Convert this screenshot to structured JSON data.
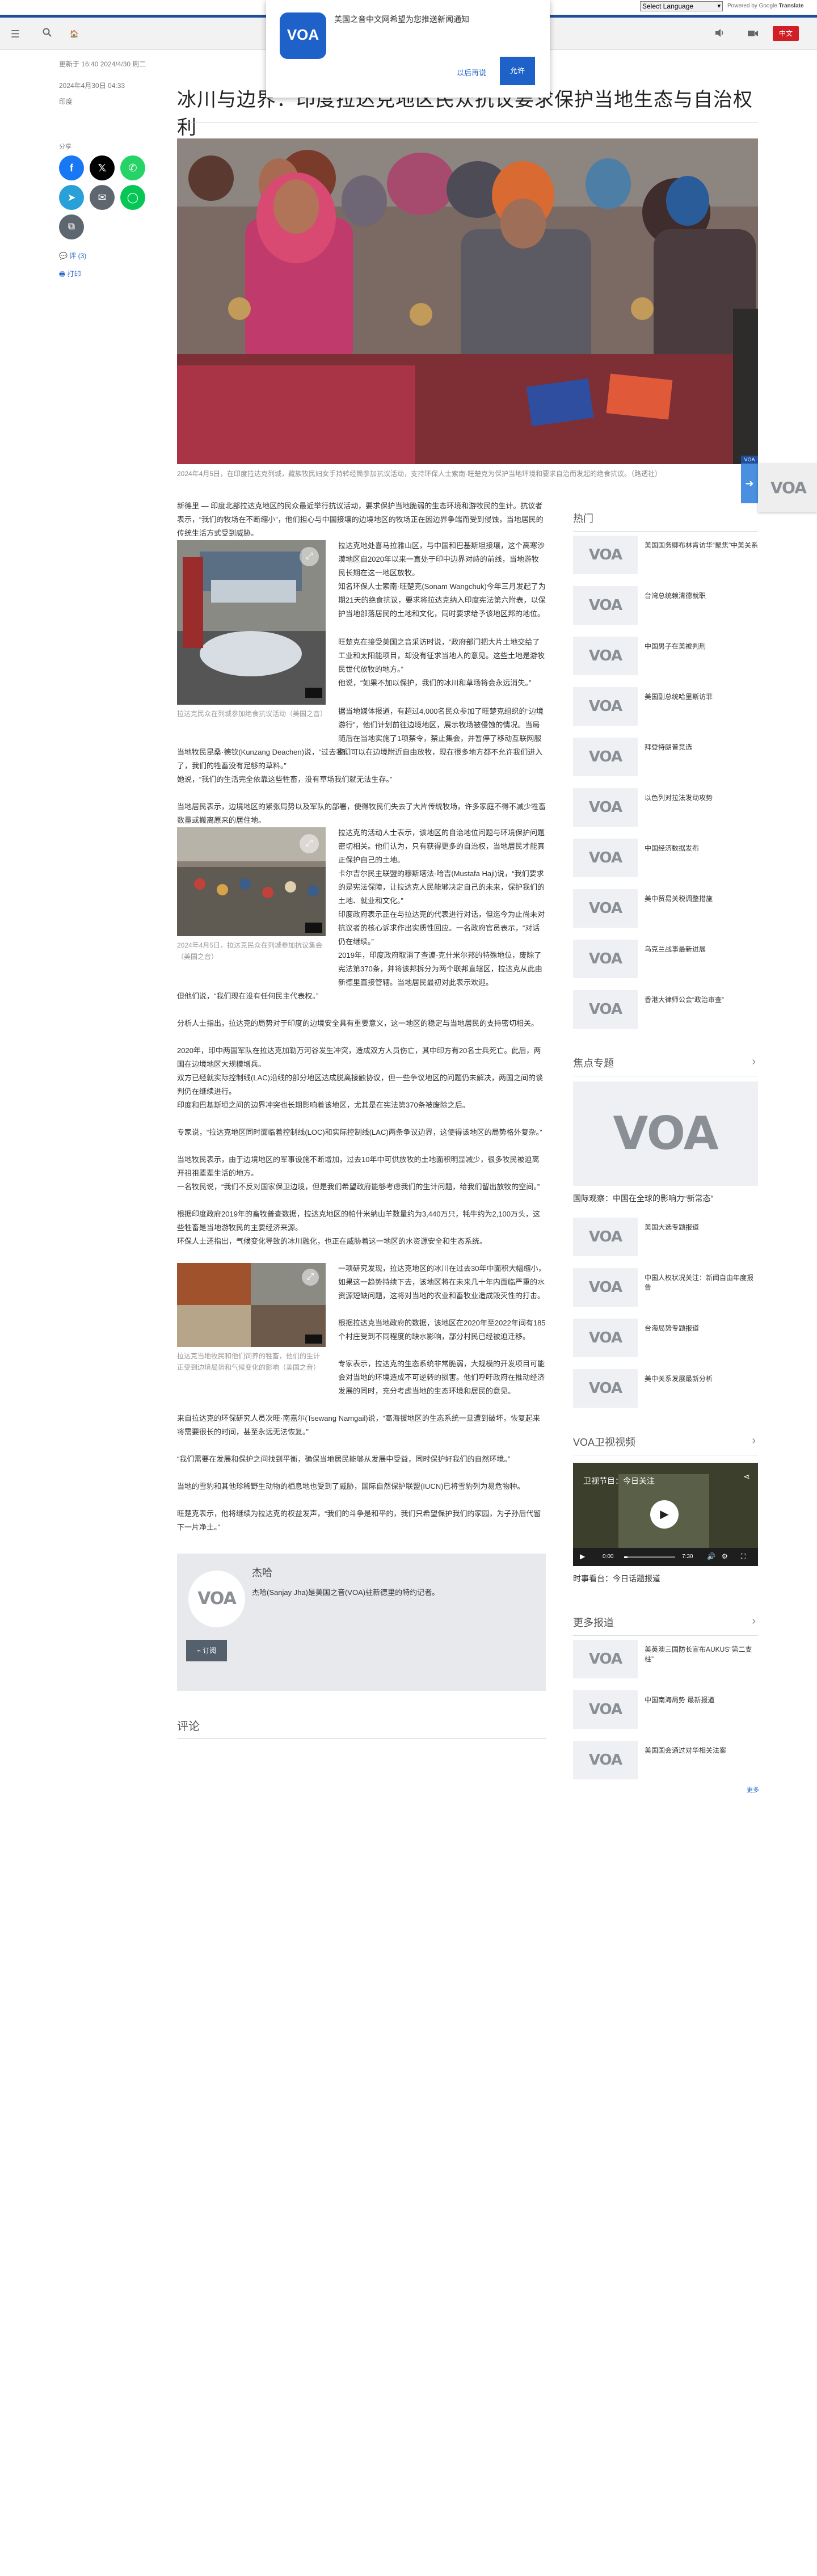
{
  "translate": {
    "select_label": "Select Language",
    "powered_prefix": "Powered by",
    "powered_google": "Google",
    "powered_translate": "Translate"
  },
  "header": {
    "menu_icon": "hamburger-icon",
    "search_icon": "search-icon",
    "home_label": "🏠",
    "audio_icon": "speaker-icon",
    "video_icon": "camera-icon",
    "lang_button": "中文",
    "accent_color": "#d21f25",
    "brand_color": "#1e4e9c"
  },
  "popup": {
    "logo_text": "VOA",
    "message": "美国之音中文网希望为您推送新闻通知",
    "later_label": "以后再说",
    "allow_label": "允许"
  },
  "meta": {
    "updated": "更新于 16:40 2024/4/30 周二",
    "published": "2024年4月30日 04:33",
    "author": "印度"
  },
  "article": {
    "title": "冰川与边界：印度拉达克地区民众抗议要求保护当地生态与自治权利",
    "hero_caption": "2024年4月5日，在印度拉达克列城，藏族牧民妇女手持转经筒参加抗议活动，支持环保人士索南·旺楚克为保护当地环境和要求自治而发起的绝食抗议。（路透社）",
    "share_label": "分享",
    "comments_label": "评 (3)",
    "print_label": "打印",
    "paragraphs": {
      "p0": "新德里 — 印度北部拉达克地区的民众最近举行抗议活动，要求保护当地脆弱的生态环境和游牧民的生计。抗议者表示，“我们的牧场在不断缩小”，他们担心与中国接壤的边境地区的牧场正在因边界争端而受到侵蚀，当地居民的传统生活方式受到威胁。",
      "p1": "拉达克地处喜马拉雅山区，与中国和巴基斯坦接壤，这个高寒沙漠地区自2020年以来一直处于印中边界对峙的前线，当地游牧民长期在这一地区放牧。",
      "p2": "知名环保人士索南·旺楚克(Sonam Wangchuk)今年三月发起了为期21天的绝食抗议，要求将拉达克纳入印度宪法第六附表，以保护当地部落居民的土地和文化，同时要求给予该地区邦的地位。",
      "p3": "旺楚克在接受美国之音采访时说，“政府部门把大片土地交给了工业和太阳能项目，却没有征求当地人的意见。这些土地是游牧民世代放牧的地方。”",
      "p4": "他说，“如果不加以保护，我们的冰川和草场将会永远消失。”",
      "p5": "据当地媒体报道，有超过4,000名民众参加了旺楚克组织的“边境游行”，他们计划前往边境地区，展示牧场被侵蚀的情况。当局随后在当地实施了1项禁令，禁止集会，并暂停了移动互联网服务。",
      "p6": "当地牧民昆桑·德钦(Kunzang Deachen)说，“过去我们可以在边境附近自由放牧，现在很多地方都不允许我们进入了，我们的牲畜没有足够的草料。”",
      "p7": "她说，“我们的生活完全依靠这些牲畜，没有草场我们就无法生存。”",
      "p8": "当地居民表示，边境地区的紧张局势以及军队的部署，使得牧民们失去了大片传统牧场，许多家庭不得不减少牲畜数量或搬离原来的居住地。",
      "p9": "拉达克的活动人士表示，该地区的自治地位问题与环境保护问题密切相关。他们认为，只有获得更多的自治权，当地居民才能真正保护自己的土地。",
      "p10": "卡尔吉尔民主联盟的穆斯塔法·哈吉(Mustafa Haji)说，“我们要求的是宪法保障，让拉达克人民能够决定自己的未来，保护我们的土地、就业和文化。”",
      "p11": "印度政府表示正在与拉达克的代表进行对话，但迄今为止尚未对抗议者的核心诉求作出实质性回应。一名政府官员表示，“对话仍在继续。”",
      "p12": "2019年，印度政府取消了查谟-克什米尔邦的特殊地位，废除了宪法第370条，并将该邦拆分为两个联邦直辖区，拉达克从此由新德里直接管辖。当地居民最初对此表示欢迎。",
      "p13": "但他们说，“我们现在没有任何民主代表权。”",
      "p14": "分析人士指出，拉达克的局势对于印度的边境安全具有重要意义，这一地区的稳定与当地居民的支持密切相关。",
      "p15": "2020年，印中两国军队在拉达克加勒万河谷发生冲突，造成双方人员伤亡，其中印方有20名士兵死亡。此后，两国在边境地区大规模增兵。",
      "p16": "双方已经就实际控制线(LAC)沿线的部分地区达成脱离接触协议，但一些争议地区的问题仍未解决，两国之间的谈判仍在继续进行。",
      "p17": "印度和巴基斯坦之间的边界冲突也长期影响着该地区，尤其是在宪法第370条被废除之后。",
      "p18": "专家说，“拉达克地区同时面临着控制线(LOC)和实际控制线(LAC)两条争议边界，这使得该地区的局势格外复杂。”",
      "p19": "当地牧民表示，由于边境地区的军事设施不断增加，过去10年中可供放牧的土地面积明显减少，很多牧民被迫离开祖祖辈辈生活的地方。",
      "p20": "一名牧民说，“我们不反对国家保卫边境，但是我们希望政府能够考虑我们的生计问题，给我们留出放牧的空间。”",
      "p21": "根据印度政府2019年的畜牧普查数据，拉达克地区的帕什米纳山羊数量约为3,440万只，牦牛约为2,100万头，这些牲畜是当地游牧民的主要经济来源。",
      "p22": "环保人士还指出，气候变化导致的冰川融化，也正在威胁着这一地区的水资源安全和生态系统。",
      "p23": "一项研究发现，拉达克地区的冰川在过去30年中面积大幅缩小，如果这一趋势持续下去，该地区将在未来几十年内面临严重的水资源短缺问题，这将对当地的农业和畜牧业造成毁灭性的打击。",
      "p24": "根据拉达克当地政府的数据，该地区在2020年至2022年间有185个村庄受到不同程度的缺水影响，部分村民已经被迫迁移。",
      "p25": "专家表示，拉达克的生态系统非常脆弱，大规模的开发项目可能会对当地的环境造成不可逆转的损害。他们呼吁政府在推动经济发展的同时，充分考虑当地的生态环境和居民的意见。",
      "p26": "来自拉达克的环保研究人员次旺·南嘉尔(Tsewang Namgail)说，“高海拔地区的生态系统一旦遭到破坏，恢复起来将需要很长的时间，甚至永远无法恢复。”",
      "p27": "“我们需要在发展和保护之间找到平衡，确保当地居民能够从发展中受益，同时保护好我们的自然环境。”",
      "p28": "当地的雪豹和其他珍稀野生动物的栖息地也受到了威胁，国际自然保护联盟(IUCN)已将雪豹列为易危物种。",
      "p29": "旺楚克表示，他将继续为拉达克的权益发声，“我们的斗争是和平的，我们只希望保护我们的家园，为子孙后代留下一片净土。”"
    },
    "inline_captions": {
      "c1": "拉达克民众在列城参加绝食抗议活动（美国之音）",
      "c2": "2024年4月5日，拉达克民众在列城参加抗议集会（美国之音）",
      "c3": "拉达克当地牧民和他们饲养的牲畜，他们的生计正受到边境局势和气候变化的影响（美国之音）"
    }
  },
  "author_box": {
    "name": "杰哈",
    "bio": "杰哈(Sanjay Jha)是美国之音(VOA)驻新德里的特约记者。",
    "rss_label": "订阅"
  },
  "comments_section": {
    "title": "评论"
  },
  "sidebar": {
    "popular_title": "热门",
    "popular": [
      "美国国务卿布林肯访华“聚焦”中美关系",
      "台湾总统赖清德就职",
      "中国男子在美被判刑",
      "美国副总统哈里斯访菲",
      "拜登特朗普竞选",
      "以色列对拉法发动攻势",
      "中国经济数据发布",
      "美中贸易关税调整措施",
      "乌克兰战事最新进展",
      "香港大律师公会“政治审查”"
    ],
    "features_title": "焦点专题",
    "feature_main": "国际观察：中国在全球的影响力“新常态”",
    "features": [
      "美国大选专题报道",
      "中国人权状况关注：新闻自由年度报告",
      "台海局势专题报道",
      "美中关系发展最新分析"
    ],
    "video_title": "VOA卫视视频",
    "video_overlay": "卫视节目：今日关注",
    "video_time_current": "0:00",
    "video_time_total": "7:30",
    "video_caption": "时事看台：今日话题报道",
    "more_title": "更多报道",
    "more": [
      "美英澳三国防长宣布AUKUS“第二支柱”",
      "中国南海局势 最新报道",
      "美国国会通过对华相关法案"
    ],
    "more_link": "更多"
  },
  "widget": {
    "tag": "VOA",
    "logo": "VOA"
  },
  "logo_text": "VOA"
}
